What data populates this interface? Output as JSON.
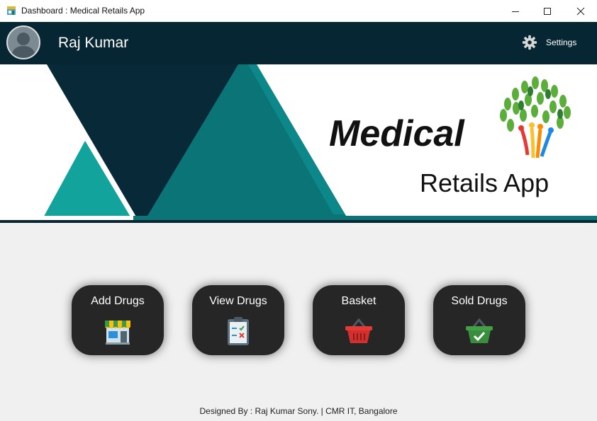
{
  "window": {
    "title": "Dashboard : Medical Retails App",
    "app_icon": "app-window-icon",
    "controls": [
      "minimize-icon",
      "maximize-icon",
      "close-icon"
    ]
  },
  "header": {
    "user_name": "Raj Kumar",
    "avatar_icon": "user-avatar-icon",
    "settings_label": "Settings",
    "settings_icon": "gear-icon"
  },
  "banner": {
    "line1": "Medical",
    "line2": "Retails App",
    "logo_icon": "tree-people-logo"
  },
  "tiles": [
    {
      "label": "Add Drugs",
      "icon": "store-icon"
    },
    {
      "label": "View Drugs",
      "icon": "clipboard-checklist-icon"
    },
    {
      "label": "Basket",
      "icon": "basket-icon"
    },
    {
      "label": "Sold Drugs",
      "icon": "basket-check-icon"
    }
  ],
  "footer": {
    "text": "Designed By :  Raj Kumar Sony.  |  CMR IT, Bangalore"
  },
  "colors": {
    "header_bg": "#072633",
    "teal_dark": "#0b7477",
    "teal_light": "#11a39c",
    "tile_bg": "#262626",
    "main_bg": "#f0f0f0"
  }
}
